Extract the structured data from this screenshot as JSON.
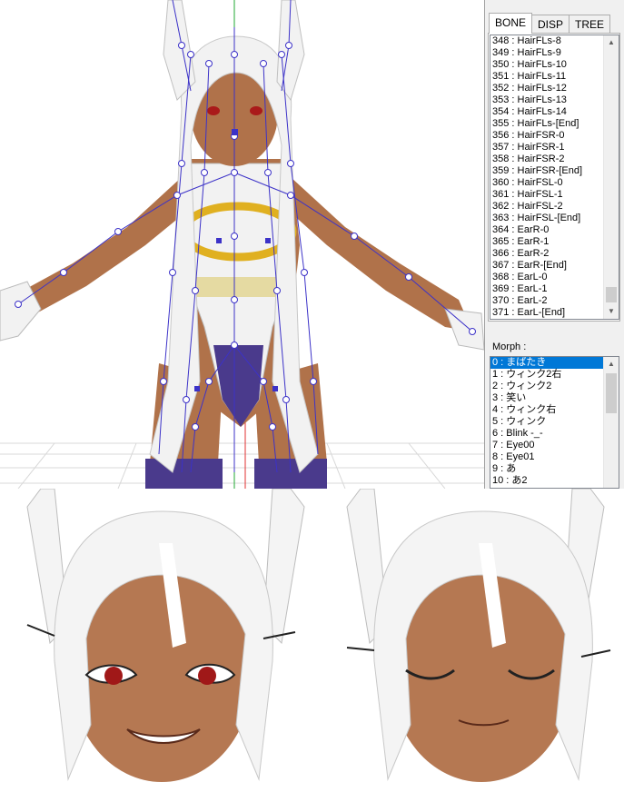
{
  "bone_panel": {
    "tabs": [
      {
        "label": "BONE",
        "active": true
      },
      {
        "label": "DISP",
        "active": false
      },
      {
        "label": "TREE",
        "active": false
      }
    ],
    "items": [
      "348 : HairFLs-8",
      "349 : HairFLs-9",
      "350 : HairFLs-10",
      "351 : HairFLs-11",
      "352 : HairFLs-12",
      "353 : HairFLs-13",
      "354 : HairFLs-14",
      "355 : HairFLs-[End]",
      "356 : HairFSR-0",
      "357 : HairFSR-1",
      "358 : HairFSR-2",
      "359 : HairFSR-[End]",
      "360 : HairFSL-0",
      "361 : HairFSL-1",
      "362 : HairFSL-2",
      "363 : HairFSL-[End]",
      "364 : EarR-0",
      "365 : EarR-1",
      "366 : EarR-2",
      "367 : EarR-[End]",
      "368 : EarL-0",
      "369 : EarL-1",
      "370 : EarL-2",
      "371 : EarL-[End]"
    ]
  },
  "morph_panel": {
    "label": "Morph :",
    "selected_index": 0,
    "items": [
      "0 : まばたき",
      "1 : ウィンク2右",
      "2 : ウィンク2",
      "3 : 笑い",
      "4 : ウィンク右",
      "5 : ウィンク",
      "6 : Blink -_-",
      "7 : Eye00",
      "8 : Eye01",
      "9 : あ",
      "10 : あ2"
    ]
  },
  "colors": {
    "selection": "#0078d7",
    "bone_wire": "#3c32c8",
    "skin": "#b0724a",
    "hair": "#f2f2f2",
    "suit_purple": "#4a3a8c",
    "gold": "#e0b020"
  },
  "icons": [
    "scroll-up-arrow-icon",
    "scroll-down-arrow-icon"
  ]
}
